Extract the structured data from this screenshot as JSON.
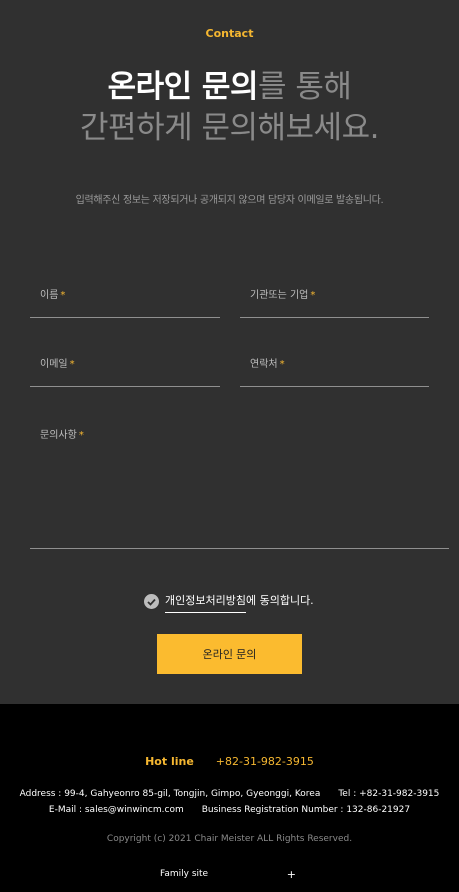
{
  "header": {
    "section_label": "Contact",
    "headline_strong": "온라인 문의",
    "headline_rest": "를 통해",
    "headline_line2": "간편하게 문의해보세요.",
    "subtitle": "입력해주신 정보는 저장되거나 공개되지 않으며 담당자 이메일로 발송됩니다."
  },
  "form": {
    "required_mark": "*",
    "name_label": "이름",
    "company_label": "기관또는 기업",
    "email_label": "이메일",
    "phone_label": "연락처",
    "inquiry_label": "문의사항",
    "name_value": "",
    "company_value": "",
    "email_value": "",
    "phone_value": "",
    "inquiry_value": ""
  },
  "agreement": {
    "link_text": "개인정보처리방침",
    "suffix": "에 동의합니다.",
    "checked": true
  },
  "submit": {
    "label": "온라인 문의"
  },
  "footer": {
    "hotline_label": "Hot line",
    "hotline_number": "+82-31-982-3915",
    "address": "Address : 99-4, Gahyeonro 85-gil, Tongjin, Gimpo, Gyeonggi, Korea",
    "tel": "Tel : +82-31-982-3915",
    "email": "E-Mail : sales@winwincm.com",
    "business_reg": "Business Registration Number : 132-86-21927",
    "copyright": "Copyright (c) 2021 Chair Meister ALL Rights Reserved.",
    "family_site_label": "Family site",
    "family_site_icon": "+"
  },
  "colors": {
    "accent": "#fbbb2f",
    "background": "#303030",
    "footer_background": "#000000"
  },
  "icons": {
    "agree_check": "check-circle-icon",
    "family_site_toggle": "plus-icon"
  }
}
